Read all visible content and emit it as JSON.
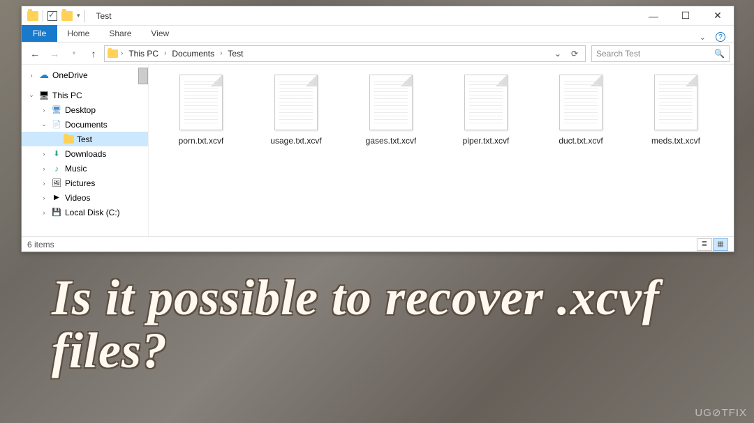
{
  "titlebar": {
    "title": "Test"
  },
  "ribbon": {
    "file": "File",
    "tabs": [
      "Home",
      "Share",
      "View"
    ]
  },
  "breadcrumb": [
    "This PC",
    "Documents",
    "Test"
  ],
  "search": {
    "placeholder": "Search Test"
  },
  "sidebar": {
    "items": [
      {
        "label": "OneDrive",
        "icon": "cloud",
        "exp": ">",
        "indent": 0
      },
      {
        "label": "This PC",
        "icon": "pc",
        "exp": "v",
        "indent": 0
      },
      {
        "label": "Desktop",
        "icon": "desktop",
        "exp": ">",
        "indent": 1
      },
      {
        "label": "Documents",
        "icon": "docs",
        "exp": "v",
        "indent": 1
      },
      {
        "label": "Test",
        "icon": "folder",
        "exp": "",
        "indent": 2,
        "selected": true
      },
      {
        "label": "Downloads",
        "icon": "dl",
        "exp": ">",
        "indent": 1
      },
      {
        "label": "Music",
        "icon": "music",
        "exp": ">",
        "indent": 1
      },
      {
        "label": "Pictures",
        "icon": "pics",
        "exp": ">",
        "indent": 1
      },
      {
        "label": "Videos",
        "icon": "vid",
        "exp": ">",
        "indent": 1
      },
      {
        "label": "Local Disk (C:)",
        "icon": "disk",
        "exp": ">",
        "indent": 1
      }
    ]
  },
  "files": [
    {
      "name": "porn.txt.xcvf"
    },
    {
      "name": "usage.txt.xcvf"
    },
    {
      "name": "gases.txt.xcvf"
    },
    {
      "name": "piper.txt.xcvf"
    },
    {
      "name": "duct.txt.xcvf"
    },
    {
      "name": "meds.txt.xcvf"
    }
  ],
  "status": {
    "count": "6 items"
  },
  "caption": "Is it possible to recover .xcvf files?",
  "watermark": "UG⊘TFIX"
}
